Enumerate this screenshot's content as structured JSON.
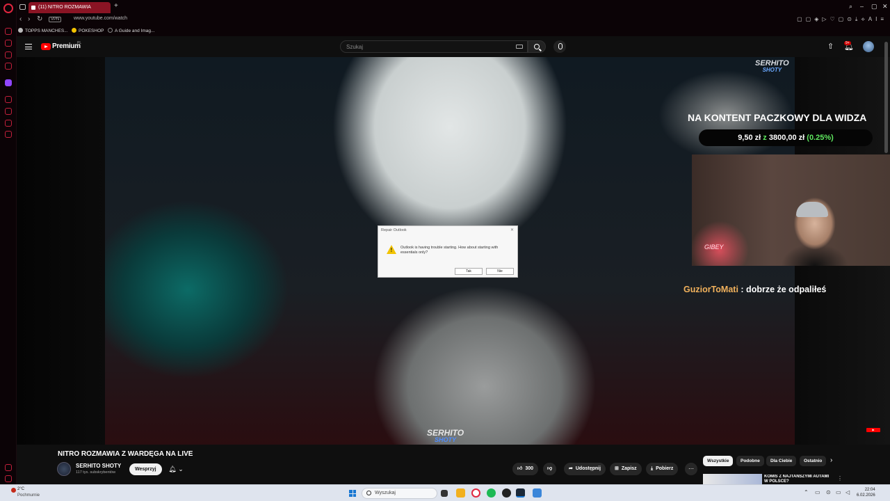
{
  "browser": {
    "tab_title": "(11) NITRO ROZMAWIA",
    "new_tab": "+",
    "vpn_label": "VPN",
    "url": "www.youtube.com/watch",
    "bookmarks": [
      "TOPPS MANCHES...",
      "POKESHOP",
      "A Guide and Imag..."
    ],
    "ai_label": "AI"
  },
  "youtube": {
    "brand": "Premium",
    "region": "PL",
    "search_placeholder": "Szukaj",
    "notification_count": "9+"
  },
  "video": {
    "watermark_top": [
      "SERHITO",
      "SHOTY"
    ],
    "watermark_bottom": [
      "SERHITO",
      "SHOTY"
    ],
    "goal_title": "NA KONTENT PACZKOWY DLA WIDZA",
    "goal_current": "9,50 zł",
    "goal_sep": "z",
    "goal_target": "3800,00 zł",
    "goal_percent": "(0.25%)",
    "goal_fraction": 0.0025,
    "cam_neon": "GIBEY",
    "chat_user": "GuziorToMati",
    "chat_message": ": dobrze że odpaliłeś"
  },
  "dialog": {
    "title": "Repair Outlook",
    "message": "Outlook is having trouble starting. How about starting with essentials only?",
    "yes": "Tak",
    "no": "Nie"
  },
  "watch": {
    "title": "NITRO ROZMAWIA Z WARDĘGA NA LIVE",
    "channel_name": "SERHITO SHOTY",
    "subscribers": "117 tys. subskrybentów",
    "support_label": "Wesprzyj",
    "likes": "300",
    "share": "Udostępnij",
    "save": "Zapisz",
    "download": "Pobierz",
    "chips": [
      "Wszystkie",
      "Podobne",
      "Dla Ciebie",
      "Ostatnio"
    ],
    "rec_title": "KOMIS Z NAJTAŃSZYMI AUTAMI W POLSCE?"
  },
  "taskbar": {
    "temp": "2°C",
    "condition": "Pochmurnie",
    "search": "Wyszukaj",
    "time": "22:04",
    "date": "6.02.2026"
  },
  "colors": {
    "opera_red": "#e0263f",
    "yt_red": "#ff0000",
    "goal_green": "#5fe85f",
    "chat_user": "#f1b15c"
  }
}
